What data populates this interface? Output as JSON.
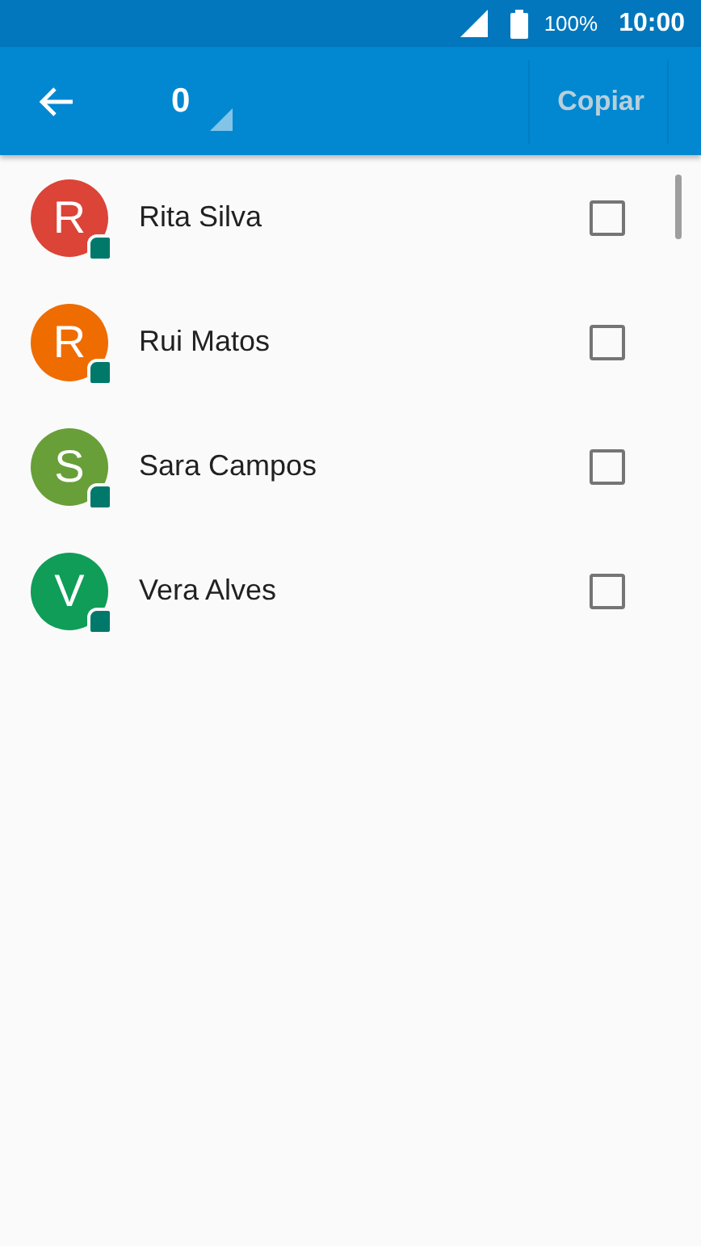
{
  "status_bar": {
    "battery": "100%",
    "time": "10:00"
  },
  "toolbar": {
    "count": "0",
    "copy_button": {
      "label": "Copiar",
      "disabled": true
    }
  },
  "contacts": [
    {
      "initial": "R",
      "name": "Rita Silva",
      "color": "#db4437",
      "checked": false
    },
    {
      "initial": "R",
      "name": "Rui Matos",
      "color": "#ef6c00",
      "checked": false
    },
    {
      "initial": "S",
      "name": "Sara Campos",
      "color": "#689f38",
      "checked": false
    },
    {
      "initial": "V",
      "name": "Vera Alves",
      "color": "#0f9d58",
      "checked": false
    }
  ]
}
